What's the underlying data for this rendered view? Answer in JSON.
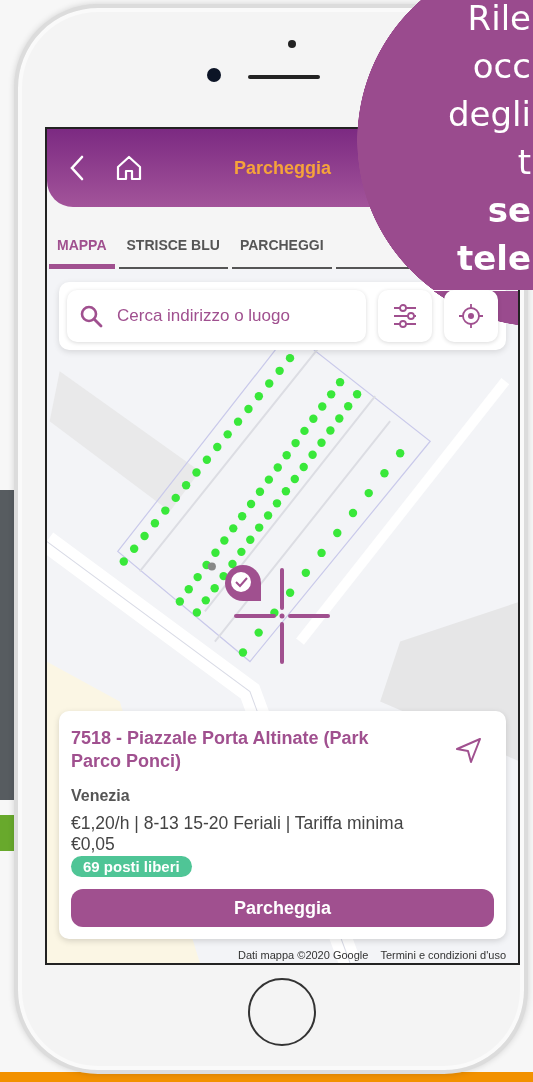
{
  "promo": {
    "lines": [
      {
        "text": "Rile",
        "bold": false
      },
      {
        "text": "occ",
        "bold": false
      },
      {
        "text": "degli",
        "bold": false
      },
      {
        "text": "t",
        "bold": false
      },
      {
        "text": "se",
        "bold": true
      },
      {
        "text": "tele",
        "bold": true
      }
    ]
  },
  "header": {
    "title": "Parcheggia"
  },
  "tabs": [
    {
      "label": "MAPPA",
      "selected": true
    },
    {
      "label": "STRISCE BLU",
      "selected": false
    },
    {
      "label": "PARCHEGGI",
      "selected": false
    }
  ],
  "search": {
    "placeholder": "Cerca indirizzo o luogo"
  },
  "parking": {
    "title": "7518 - Piazzale Porta Altinate (Park Parco Ponci)",
    "city": "Venezia",
    "info": "€1,20/h | 8-13 15-20 Feriali | Tariffa minima €0,05",
    "availability": "69 posti liberi",
    "action": "Parcheggia"
  },
  "map_footer": {
    "attribution": "Dati mappa ©2020 Google",
    "terms": "Termini e condizioni d'uso"
  }
}
